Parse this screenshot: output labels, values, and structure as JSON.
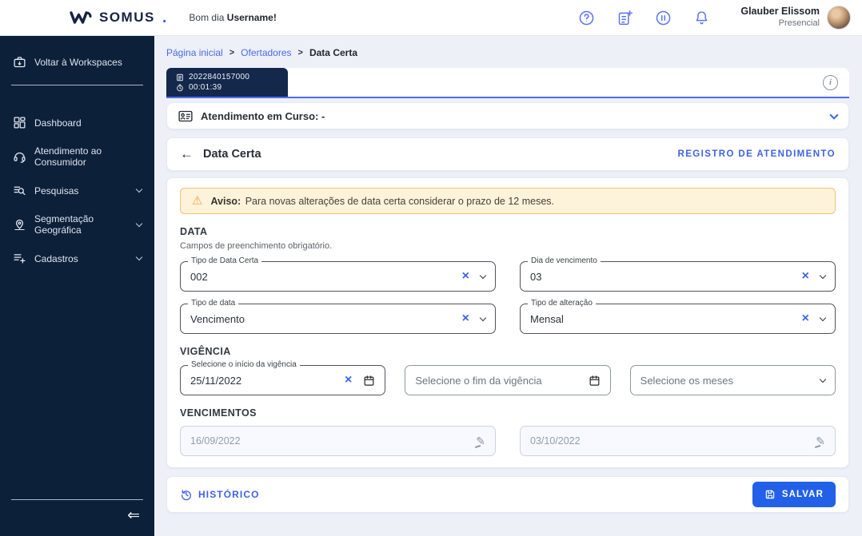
{
  "header": {
    "logo_text": "SOMUS",
    "logo_suffix": ".",
    "greeting_prefix": "Bom dia",
    "greeting_name": "Username!",
    "user": {
      "name": "Glauber Elissom",
      "status": "Presencial"
    }
  },
  "sidebar": {
    "back_label": "Voltar à Workspaces",
    "items": [
      {
        "label": "Dashboard",
        "icon": "dashboard-icon",
        "has_chevron": false
      },
      {
        "label": "Atendimento ao Consumidor",
        "icon": "headset-icon",
        "has_chevron": false
      },
      {
        "label": "Pesquisas",
        "icon": "search-list-icon",
        "has_chevron": true
      },
      {
        "label": "Segmentação Geográfica",
        "icon": "map-pin-icon",
        "has_chevron": true
      },
      {
        "label": "Cadastros",
        "icon": "list-add-icon",
        "has_chevron": true
      }
    ]
  },
  "breadcrumb": {
    "items": [
      "Página inicial",
      "Ofertadores",
      "Data Certa"
    ],
    "separator": ">"
  },
  "session_tab": {
    "id": "2022840157000",
    "timer": "00:01:39"
  },
  "attendance": {
    "label": "Atendimento em Curso: -"
  },
  "page": {
    "title": "Data Certa",
    "action_link": "REGISTRO DE ATENDIMENTO",
    "warning": {
      "bold": "Aviso:",
      "text": "Para novas alterações de data certa considerar o prazo de 12 meses."
    },
    "sections": {
      "data": {
        "title": "DATA",
        "subtitle": "Campos de preenchimento obrigatório.",
        "fields": [
          {
            "label": "Tipo de Data Certa",
            "value": "002"
          },
          {
            "label": "Dia de vencimento",
            "value": "03"
          },
          {
            "label": "Tipo de data",
            "value": "Vencimento"
          },
          {
            "label": "Tipo de alteração",
            "value": "Mensal"
          }
        ]
      },
      "vigencia": {
        "title": "VIGÊNCIA",
        "start": {
          "label": "Selecione o início da vigência",
          "value": "25/11/2022"
        },
        "end_placeholder": "Selecione o fim da vigência",
        "months_placeholder": "Selecione os meses"
      },
      "vencimentos": {
        "title": "VENCIMENTOS",
        "values": [
          "16/09/2022",
          "03/10/2022"
        ]
      }
    },
    "footer": {
      "history_label": "HISTÓRICO",
      "save_label": "SALVAR"
    }
  },
  "icons": {
    "back": "←",
    "clear": "×",
    "edit": "✎",
    "warning": "⚠",
    "collapse": "⇐",
    "info": "i",
    "question": "?"
  },
  "colors": {
    "sidebar_bg": "#0d2039",
    "tab_bg": "#13284a",
    "accent_blue": "#3f62e8",
    "header_icon_blue": "#5b74f0",
    "save_button": "#2360e8",
    "tab_underline": "#4a6cf6",
    "warning_bg": "#fdf3da",
    "warning_border": "#f1c475",
    "warning_icon": "#eda43a",
    "page_bg": "#edf0f7"
  }
}
